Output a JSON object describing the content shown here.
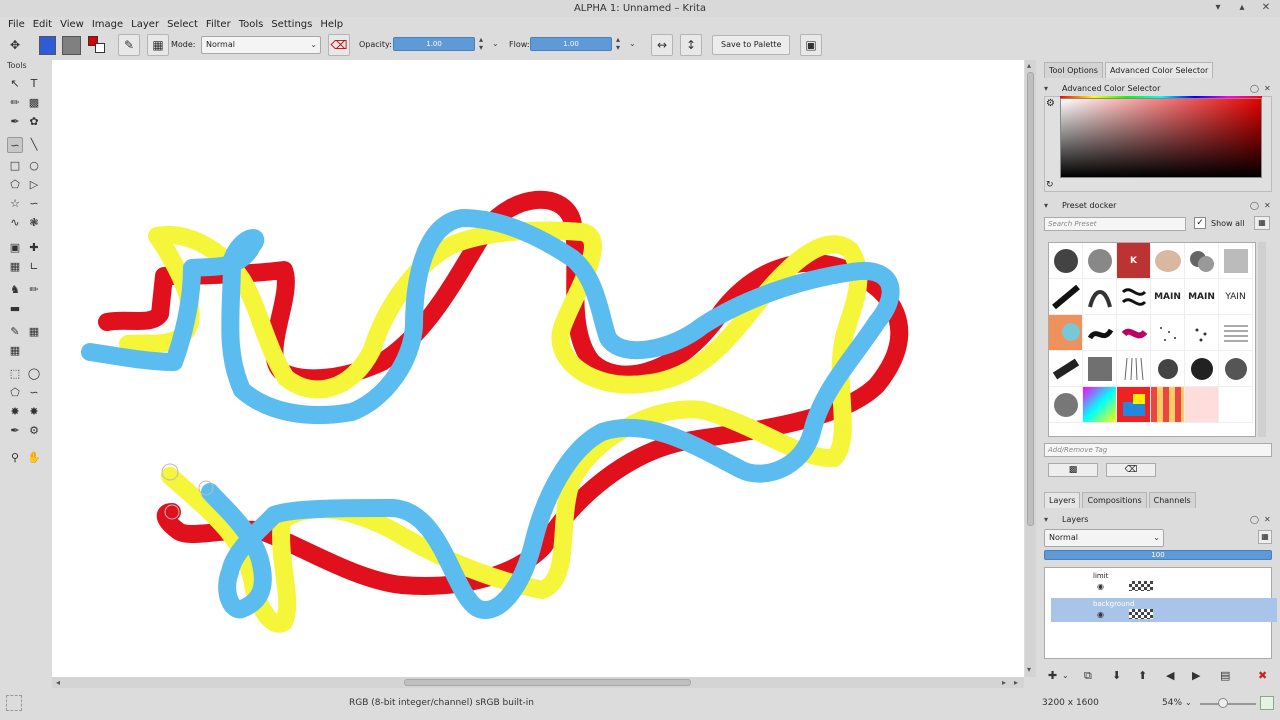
{
  "window": {
    "title": "ALPHA 1: Unnamed – Krita"
  },
  "menu": [
    "File",
    "Edit",
    "View",
    "Image",
    "Layer",
    "Select",
    "Filter",
    "Tools",
    "Settings",
    "Help"
  ],
  "toolbar": {
    "mode_label": "Mode:",
    "mode_value": "Normal",
    "opacity_label": "Opacity:",
    "opacity_value": "1.00",
    "flow_label": "Flow:",
    "flow_value": "1.00",
    "save_to_palette": "Save to Palette",
    "colors": {
      "foreground": "#2f5bd8",
      "background": "#808080"
    }
  },
  "toolbox": {
    "title": "Tools"
  },
  "canvas": {
    "background": "#ffffff",
    "stroke_colors": {
      "red": "#e0101c",
      "yellow": "#f5f53a",
      "blue": "#5bbcf0"
    }
  },
  "status": {
    "color_space": "RGB (8-bit integer/channel)  sRGB built-in",
    "dimensions": "3200 x 1600",
    "zoom": "54%"
  },
  "docker_tabs": [
    "Tool Options",
    "Advanced Color Selector"
  ],
  "color_selector": {
    "title": "Advanced Color Selector",
    "base_color": "#e40000"
  },
  "preset_docker": {
    "title": "Preset docker",
    "search_placeholder": "Search Preset",
    "show_all": "Show all",
    "tag_placeholder": "Add/Remove Tag",
    "presets": [
      "K",
      "MAIN",
      "MAIN",
      "YAIN"
    ]
  },
  "layer_tabs": [
    "Layers",
    "Compositions",
    "Channels"
  ],
  "layers": {
    "title": "Layers",
    "blend_mode": "Normal",
    "opacity": "100",
    "items": [
      {
        "name": "limit"
      },
      {
        "name": "background"
      }
    ]
  }
}
